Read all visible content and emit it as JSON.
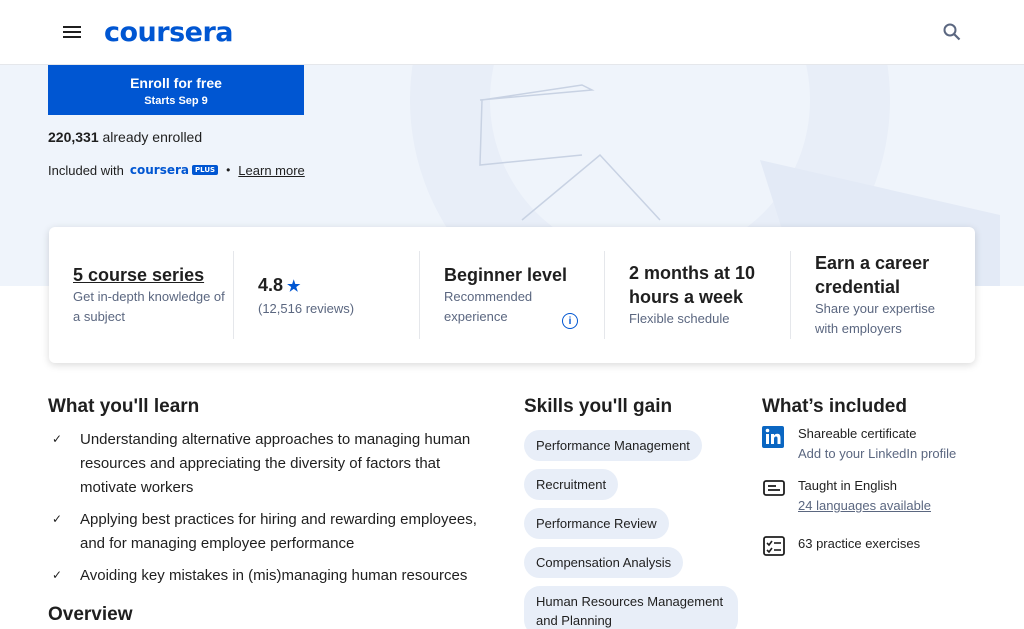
{
  "header": {
    "logo_text": "coursera",
    "menu_icon": "hamburger-menu-icon",
    "search_icon": "search-icon"
  },
  "enroll": {
    "label": "Enroll for free",
    "starts": "Starts Sep 9"
  },
  "enrolled": {
    "count": "220,331",
    "suffix": "already enrolled"
  },
  "included": {
    "prefix": "Included with",
    "brand": "coursera",
    "badge": "PLUS",
    "separator": "•",
    "learn_more": "Learn more"
  },
  "stats": [
    {
      "title": "5 course series",
      "sub": "Get in-depth knowledge of a subject"
    },
    {
      "title": "4.8",
      "sub": "(12,516 reviews)"
    },
    {
      "title": "Beginner level",
      "sub": "Recommended experience"
    },
    {
      "title": "2 months at 10 hours a week",
      "sub": "Flexible schedule"
    },
    {
      "title": "Earn a career credential",
      "sub": "Share your expertise with employers"
    }
  ],
  "learn": {
    "heading": "What you'll learn",
    "items": [
      "Understanding alternative approaches to managing human resources and appreciating the diversity of factors that motivate workers",
      "Applying best practices for hiring and rewarding employees, and for managing employee performance",
      "Avoiding key mistakes in (mis)managing human resources"
    ]
  },
  "overview": {
    "heading": "Overview"
  },
  "skills": {
    "heading": "Skills you'll gain",
    "items": [
      "Performance Management",
      "Recruitment",
      "Performance Review",
      "Compensation Analysis",
      "Human Resources Management and Planning"
    ]
  },
  "whats_included": {
    "heading": "What’s included",
    "items": [
      {
        "icon": "linkedin-icon",
        "main": "Shareable certificate",
        "sub": "Add to your LinkedIn profile"
      },
      {
        "icon": "subtitles-icon",
        "main": "Taught in English",
        "sub": "24 languages available"
      },
      {
        "icon": "exercise-checklist-icon",
        "main": "63 practice exercises",
        "sub": ""
      }
    ]
  },
  "colors": {
    "brand": "#0056d2",
    "hero_bg": "#eff4fb",
    "chip_bg": "#e8eef8"
  }
}
